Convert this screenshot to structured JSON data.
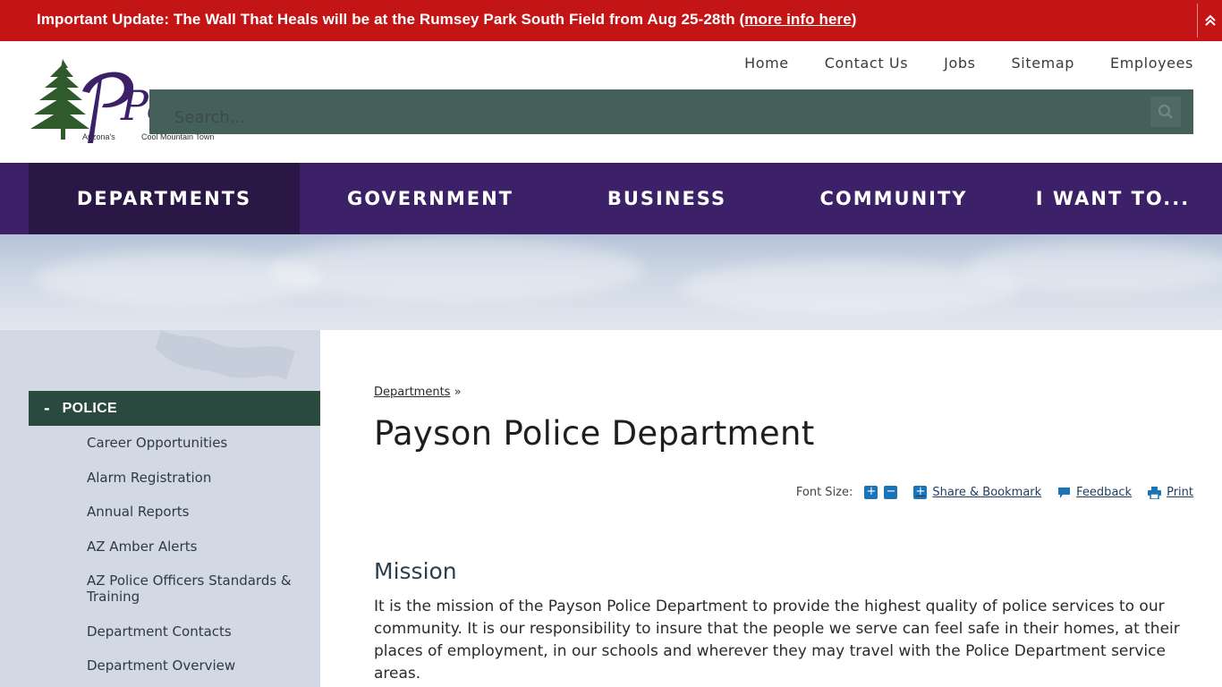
{
  "alert": {
    "message": "Important Update: The Wall That Heals will be at the Rumsey Park South Field from Aug 25-28th (",
    "link_text": "more info here",
    "suffix": ")"
  },
  "logo": {
    "wordmark": "Pay",
    "tagline_1": "Arizona's",
    "tagline_2": "Cool Mountain Town"
  },
  "top_links": [
    "Home",
    "Contact Us",
    "Jobs",
    "Sitemap",
    "Employees"
  ],
  "search": {
    "placeholder": "Search..."
  },
  "main_nav": [
    "DEPARTMENTS",
    "GOVERNMENT",
    "BUSINESS",
    "COMMUNITY",
    "I WANT TO..."
  ],
  "sidebar": {
    "section_toggle": "-",
    "section_title": "POLICE",
    "items": [
      "Career Opportunities",
      "Alarm Registration",
      "Annual Reports",
      "AZ Amber Alerts",
      "AZ Police Officers Standards & Training",
      "Department Contacts",
      "Department Overview"
    ]
  },
  "breadcrumb": {
    "link": "Departments",
    "separator": "»"
  },
  "page_title": "Payson Police Department",
  "tools": {
    "font_size_label": "Font Size:",
    "increase": "+",
    "decrease": "−",
    "share": "Share & Bookmark",
    "feedback": "Feedback",
    "print": "Print"
  },
  "mission": {
    "title": "Mission",
    "body": "It is the mission of the Payson Police Department to provide the highest quality of police services to our community. It is our responsibility to insure that the people we serve can feel safe in their homes, at their places of employment, in our schools and wherever they may travel with the Police Department service areas."
  },
  "colors": {
    "alert_red": "#c31515",
    "nav_purple": "#3c2068",
    "nav_active": "#2a1746",
    "search_green": "#45605a",
    "sidebar_head": "#2a4a40",
    "tool_blue": "#1a74b7"
  }
}
